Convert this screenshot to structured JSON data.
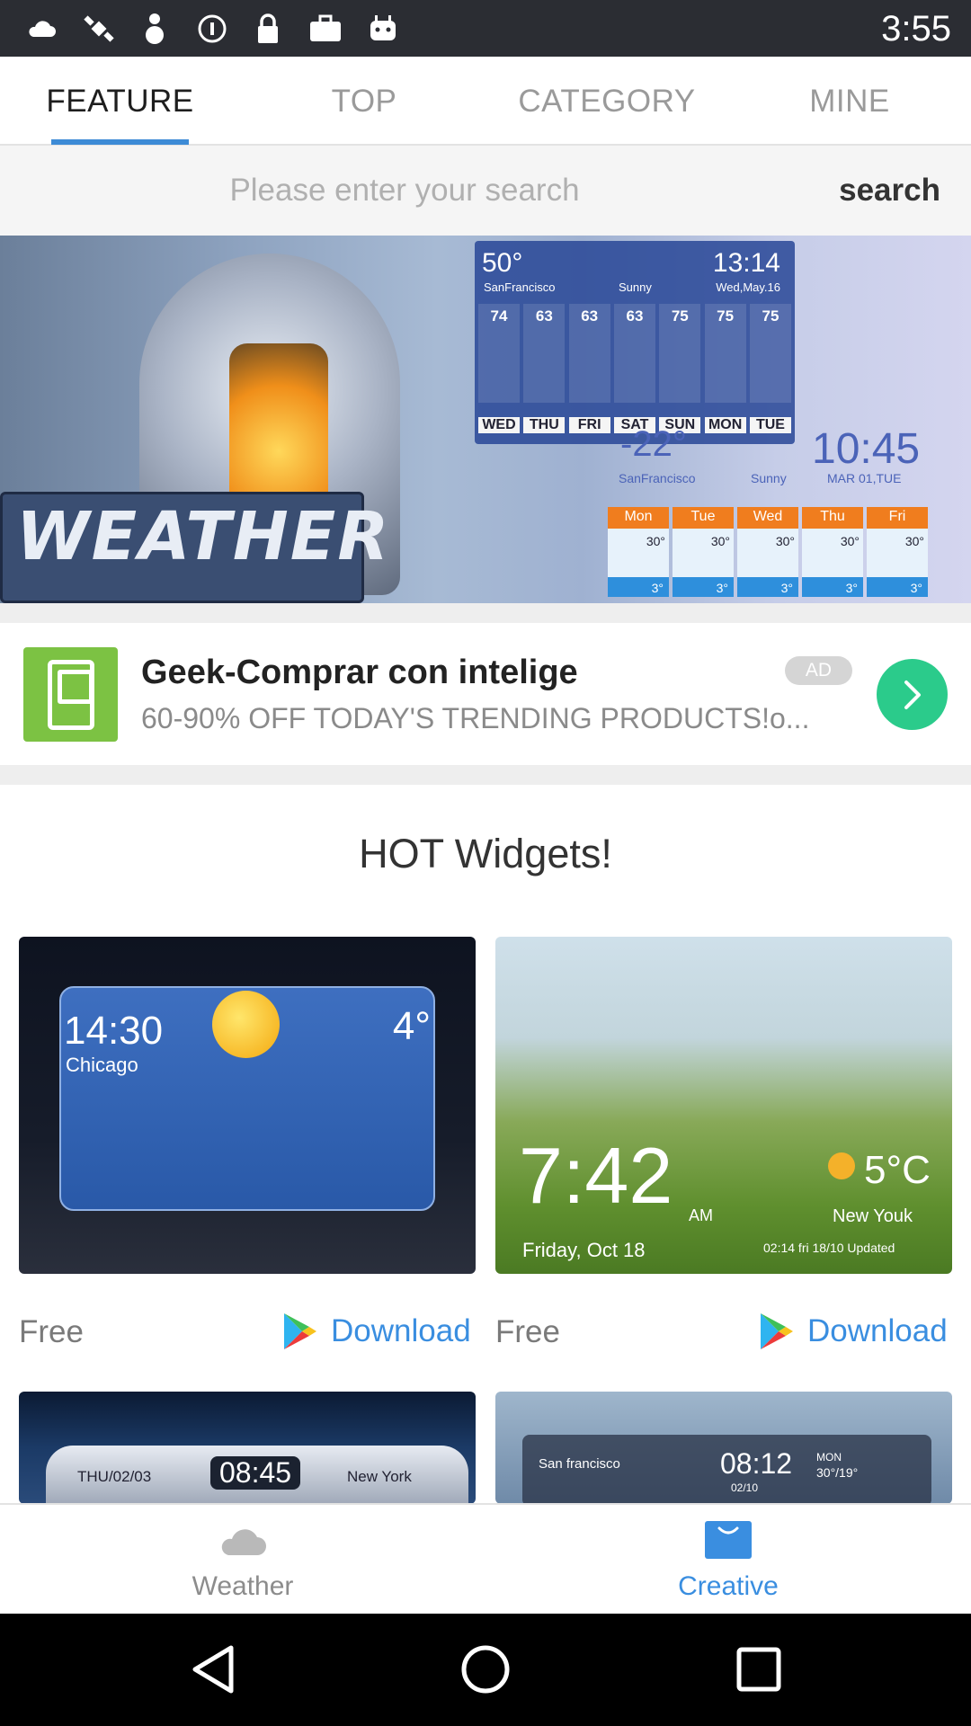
{
  "status_bar": {
    "time": "3:55",
    "icons": [
      "cloud-icon",
      "satellite-icon",
      "tie-icon",
      "info-icon",
      "lock-icon",
      "briefcase-icon",
      "android-icon"
    ]
  },
  "tabs": [
    {
      "label": "FEATURE",
      "active": true
    },
    {
      "label": "TOP",
      "active": false
    },
    {
      "label": "CATEGORY",
      "active": false
    },
    {
      "label": "MINE",
      "active": false
    }
  ],
  "search": {
    "placeholder": "Please enter your search",
    "button_label": "search"
  },
  "banner": {
    "logo_text": "WEATHER",
    "panel_temp": "50°",
    "panel_city": "SanFrancisco",
    "panel_condition": "Sunny",
    "panel_time": "13:14",
    "panel_date": "Wed,May.16",
    "panel_highs": [
      "74",
      "63",
      "63",
      "63",
      "75",
      "75",
      "75"
    ],
    "panel_days": [
      "WED",
      "THU",
      "FRI",
      "SAT",
      "SUN",
      "MON",
      "TUE"
    ],
    "second_temp": "-22°",
    "second_city": "SanFrancisco",
    "second_condition": "Sunny",
    "second_time": "10:45",
    "second_date": "MAR 01,TUE",
    "mini_days": [
      "Mon",
      "Tue",
      "Wed",
      "Thu",
      "Fri"
    ],
    "mini_high": "30°",
    "mini_low": "3°",
    "slides_total": 2,
    "slide_active": 2
  },
  "ad": {
    "title": "Geek-Comprar con intelige",
    "subtitle": "60-90% OFF TODAY'S TRENDING PRODUCTS!o...",
    "badge": "AD"
  },
  "section": {
    "title": "HOT Widgets!"
  },
  "widgets": [
    {
      "price": "Free",
      "download_label": "Download",
      "preview": {
        "time": "14:30",
        "city": "Chicago",
        "temp": "4°"
      }
    },
    {
      "price": "Free",
      "download_label": "Download",
      "preview": {
        "time": "7:42",
        "am": "AM",
        "date": "Friday, Oct 18",
        "temp": "5°C",
        "location": "New Youk",
        "updated": "02:14 fri 18/10 Updated"
      }
    },
    {
      "preview": {
        "date": "THU/02/03",
        "time": "08:45",
        "city": "New York"
      }
    },
    {
      "preview": {
        "city": "San francisco",
        "time": "08:12",
        "date": "02/10",
        "day": "MON",
        "temps": "30°/19°"
      }
    }
  ],
  "bottom_nav": [
    {
      "label": "Weather",
      "icon": "cloud-icon",
      "active": false
    },
    {
      "label": "Creative",
      "icon": "bag-icon",
      "active": true
    }
  ],
  "colors": {
    "accent": "#3a8ee0",
    "ad_green": "#2bcb8b",
    "ad_icon_bg": "#7cc243",
    "status_bar": "#2b2d33"
  }
}
